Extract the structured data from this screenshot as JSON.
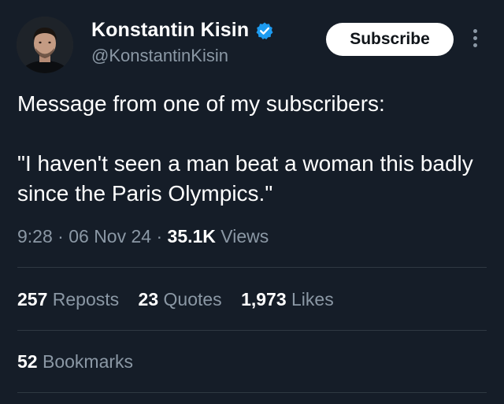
{
  "author": {
    "name": "Konstantin Kisin",
    "handle": "@KonstantinKisin",
    "verified_color": "#1d9bf0"
  },
  "actions": {
    "subscribe_label": "Subscribe",
    "more_icon": "more-vertical-icon"
  },
  "tweet": {
    "text": "Message from one of my subscribers:\n\n\"I haven't seen a man beat a woman this badly since the Paris Olympics.\""
  },
  "meta": {
    "time": "9:28",
    "sep1": " · ",
    "date": "06 Nov 24",
    "sep2": " · ",
    "views_count": "35.1K",
    "views_label": " Views"
  },
  "stats": {
    "reposts_count": "257",
    "reposts_label": "Reposts",
    "quotes_count": "23",
    "quotes_label": "Quotes",
    "likes_count": "1,973",
    "likes_label": "Likes",
    "bookmarks_count": "52",
    "bookmarks_label": "Bookmarks"
  },
  "colors": {
    "background": "#151d28",
    "text": "#ffffff",
    "secondary_text": "#8b98a5",
    "divider": "#2f3942"
  }
}
